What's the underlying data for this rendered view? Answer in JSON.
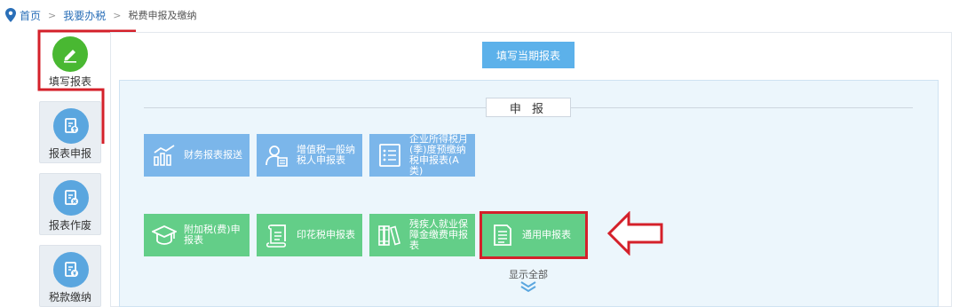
{
  "breadcrumb": {
    "home": "首页",
    "tax": "我要办税",
    "current": "税费申报及缴纳",
    "separator": ">"
  },
  "sidebar": {
    "items": [
      {
        "label": "填写报表",
        "icon": "pencil-icon"
      },
      {
        "label": "报表申报",
        "icon": "upload-report-icon"
      },
      {
        "label": "报表作废",
        "icon": "void-report-icon"
      },
      {
        "label": "税款缴纳",
        "icon": "tax-payment-icon"
      }
    ]
  },
  "main": {
    "fill_button": "填写当期报表",
    "section_title": "申 报",
    "tiles_row1": [
      {
        "label": "财务报表报送",
        "icon": "bar-chart-icon"
      },
      {
        "label": "增值税一般纳税人申报表",
        "icon": "person-form-icon"
      },
      {
        "label": "企业所得税月(季)度预缴纳税申报表(A类)",
        "icon": "list-icon"
      }
    ],
    "tiles_row2": [
      {
        "label": "附加税(费)申报表",
        "icon": "graduation-cap-icon"
      },
      {
        "label": "印花税申报表",
        "icon": "scroll-icon"
      },
      {
        "label": "残疾人就业保障金缴费申报表",
        "icon": "books-icon"
      },
      {
        "label": "通用申报表",
        "icon": "document-icon"
      }
    ],
    "show_all": "显示全部"
  },
  "colors": {
    "tile_blue": "#7bb6ea",
    "tile_green": "#63ce88",
    "annotation_red": "#d4202a",
    "link_blue": "#2a6fb8"
  }
}
